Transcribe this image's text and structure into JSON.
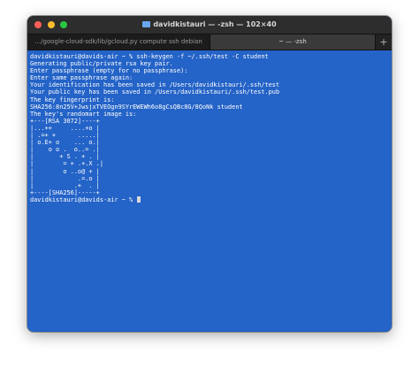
{
  "window": {
    "title": "davidkistauri — -zsh — 102×40",
    "traffic_lights": [
      {
        "name": "close-button",
        "color": "#ff5f57"
      },
      {
        "name": "minimize-button",
        "color": "#febc2e"
      },
      {
        "name": "zoom-button",
        "color": "#28c840"
      }
    ],
    "icon": "folder-icon"
  },
  "tabs": [
    {
      "label": "…/google-cloud-sdk/lib/gcloud.py compute ssh debian"
    },
    {
      "label": "~ — -zsh"
    }
  ],
  "new_tab_label": "+",
  "colors": {
    "terminal_background": "#2463c7",
    "terminal_text": "#ffffff",
    "titlebar": "#2d2d2d"
  },
  "terminal": {
    "lines": [
      "davidkistauri@davids-air ~ % ssh-keygen -f ~/.ssh/test -C student",
      "Generating public/private rsa key pair.",
      "Enter passphrase (empty for no passphrase):",
      "Enter same passphrase again:",
      "Your identification has been saved in /Users/davidkistauri/.ssh/test",
      "Your public key has been saved in /Users/davidkistauri/.ssh/test.pub",
      "The key fingerprint is:",
      "SHA256:8n25V+JwsjxTVEOgn9SYrEWEWh6o8gCsQBc8G/8QoNk student",
      "The key's randomart image is:",
      "+---[RSA 3072]----+",
      "|...++     ....+o |",
      "| .=+ +      .....|",
      "| o.E+ o    ... o.|",
      "|    o o .  o..= .|",
      "|       + S . + . |",
      "|        = + .+.X .|",
      "|        o ..o@ + |",
      "|            .=.o |",
      "|           .+  . |",
      "+----[SHA256]-----+"
    ],
    "prompt": "davidkistauri@davids-air ~ % "
  }
}
